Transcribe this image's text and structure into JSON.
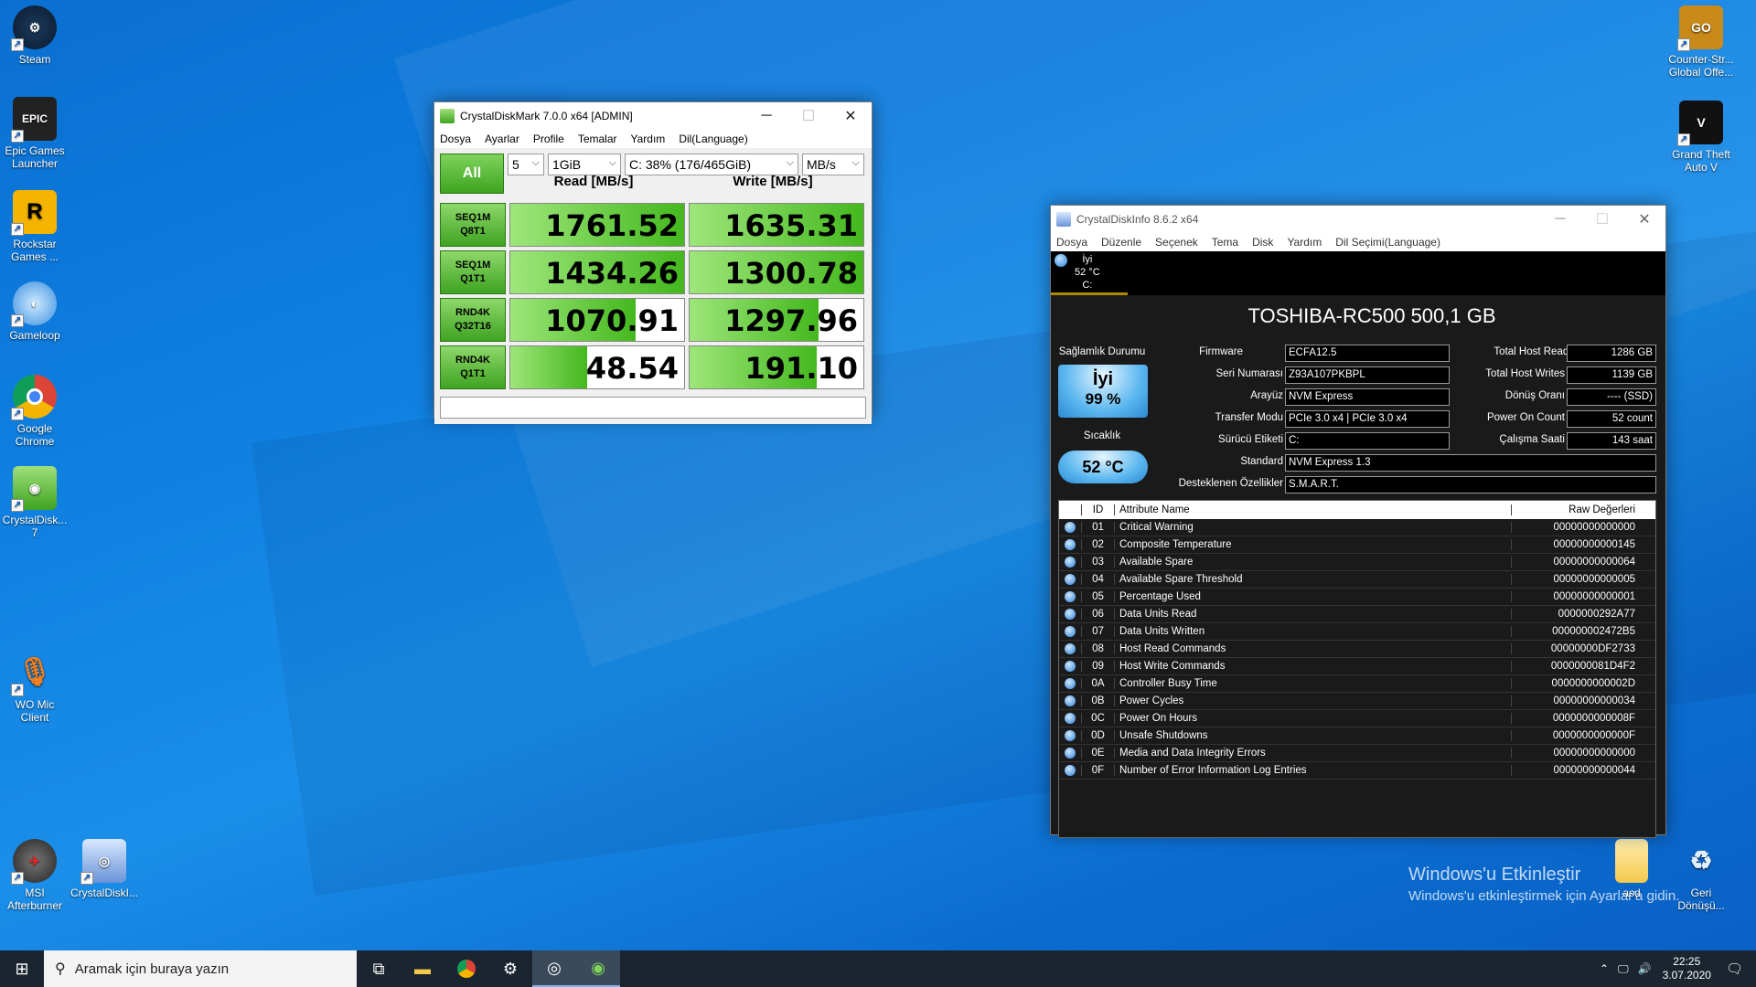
{
  "desktop": {
    "icons_left": [
      {
        "label": "Steam"
      },
      {
        "label": "Epic Games Launcher"
      },
      {
        "label": "Rockstar Games ..."
      },
      {
        "label": "Gameloop"
      },
      {
        "label": "Google Chrome"
      },
      {
        "label": "CrystalDisk... 7"
      },
      {
        "label": "WO Mic Client"
      },
      {
        "label": "MSI Afterburner"
      },
      {
        "label": "CrystalDiskI..."
      }
    ],
    "icons_right": [
      {
        "label": "Counter-Str... Global Offe..."
      },
      {
        "label": "Grand Theft Auto V"
      },
      {
        "label": "asd"
      },
      {
        "label": "Geri Dönüşü..."
      }
    ],
    "activation": {
      "title": "Windows'u Etkinleştir",
      "subtitle": "Windows'u etkinleştirmek için Ayarlar'a gidin."
    }
  },
  "cdm": {
    "title": "CrystalDiskMark 7.0.0 x64 [ADMIN]",
    "menu": [
      "Dosya",
      "Ayarlar",
      "Profile",
      "Temalar",
      "Yardım",
      "Dil(Language)"
    ],
    "all_label": "All",
    "count": "5",
    "size": "1GiB",
    "drive": "C: 38% (176/465GiB)",
    "unit": "MB/s",
    "read_header": "Read [MB/s]",
    "write_header": "Write [MB/s]",
    "rows": [
      {
        "l1": "SEQ1M",
        "l2": "Q8T1",
        "read": "1761.52",
        "write": "1635.31",
        "read_fill": 1.0,
        "write_fill": 1.0
      },
      {
        "l1": "SEQ1M",
        "l2": "Q1T1",
        "read": "1434.26",
        "write": "1300.78",
        "read_fill": 1.0,
        "write_fill": 1.0
      },
      {
        "l1": "RND4K",
        "l2": "Q32T16",
        "read": "1070.91",
        "write": "1297.96",
        "read_fill": 0.72,
        "write_fill": 0.74
      },
      {
        "l1": "RND4K",
        "l2": "Q1T1",
        "read": "48.54",
        "write": "191.10",
        "read_fill": 0.44,
        "write_fill": 0.73
      }
    ]
  },
  "cdi": {
    "title": "CrystalDiskInfo 8.6.2 x64",
    "menu": [
      "Dosya",
      "Düzenle",
      "Seçenek",
      "Tema",
      "Disk",
      "Yardım",
      "Dil Seçimi(Language)"
    ],
    "disk_tab": {
      "status": "İyi",
      "temp": "52 °C",
      "drive": "C:"
    },
    "model": "TOSHIBA-RC500 500,1 GB",
    "health_label": "Sağlamlık Durumu",
    "health_status": "İyi",
    "health_pct": "99 %",
    "temp_label": "Sıcaklık",
    "temp_value": "52 °C",
    "fields": {
      "firmware_label": "Firmware",
      "firmware": "ECFA12.5",
      "serial_label": "Seri Numarası",
      "serial": "Z93A107PKBPL",
      "interface_label": "Arayüz",
      "interface": "NVM Express",
      "transfer_label": "Transfer Modu",
      "transfer": "PCIe 3.0 x4 | PCIe 3.0 x4",
      "letter_label": "Sürücü Etiketi",
      "letter": "C:",
      "standard_label": "Standard",
      "standard": "NVM Express 1.3",
      "features_label": "Desteklenen Özellikler",
      "features": "S.M.A.R.T.",
      "reads_label": "Total Host Reads",
      "reads": "1286 GB",
      "writes_label": "Total Host Writes",
      "writes": "1139 GB",
      "rotation_label": "Dönüş Oranı",
      "rotation": "---- (SSD)",
      "poweron_label": "Power On Count",
      "poweron": "52 count",
      "hours_label": "Çalışma Saati",
      "hours": "143 saat"
    },
    "smart_headers": {
      "id": "ID",
      "name": "Attribute Name",
      "raw": "Raw Değerleri"
    },
    "smart": [
      {
        "id": "01",
        "name": "Critical Warning",
        "raw": "00000000000000"
      },
      {
        "id": "02",
        "name": "Composite Temperature",
        "raw": "00000000000145"
      },
      {
        "id": "03",
        "name": "Available Spare",
        "raw": "00000000000064"
      },
      {
        "id": "04",
        "name": "Available Spare Threshold",
        "raw": "00000000000005"
      },
      {
        "id": "05",
        "name": "Percentage Used",
        "raw": "00000000000001"
      },
      {
        "id": "06",
        "name": "Data Units Read",
        "raw": "0000000292A77"
      },
      {
        "id": "07",
        "name": "Data Units Written",
        "raw": "000000002472B5"
      },
      {
        "id": "08",
        "name": "Host Read Commands",
        "raw": "00000000DF2733"
      },
      {
        "id": "09",
        "name": "Host Write Commands",
        "raw": "0000000081D4F2"
      },
      {
        "id": "0A",
        "name": "Controller Busy Time",
        "raw": "0000000000002D"
      },
      {
        "id": "0B",
        "name": "Power Cycles",
        "raw": "00000000000034"
      },
      {
        "id": "0C",
        "name": "Power On Hours",
        "raw": "0000000000008F"
      },
      {
        "id": "0D",
        "name": "Unsafe Shutdowns",
        "raw": "0000000000000F"
      },
      {
        "id": "0E",
        "name": "Media and Data Integrity Errors",
        "raw": "00000000000000"
      },
      {
        "id": "0F",
        "name": "Number of Error Information Log Entries",
        "raw": "00000000000044"
      }
    ]
  },
  "taskbar": {
    "search_placeholder": "Aramak için buraya yazın",
    "time": "22:25",
    "date": "3.07.2020"
  }
}
